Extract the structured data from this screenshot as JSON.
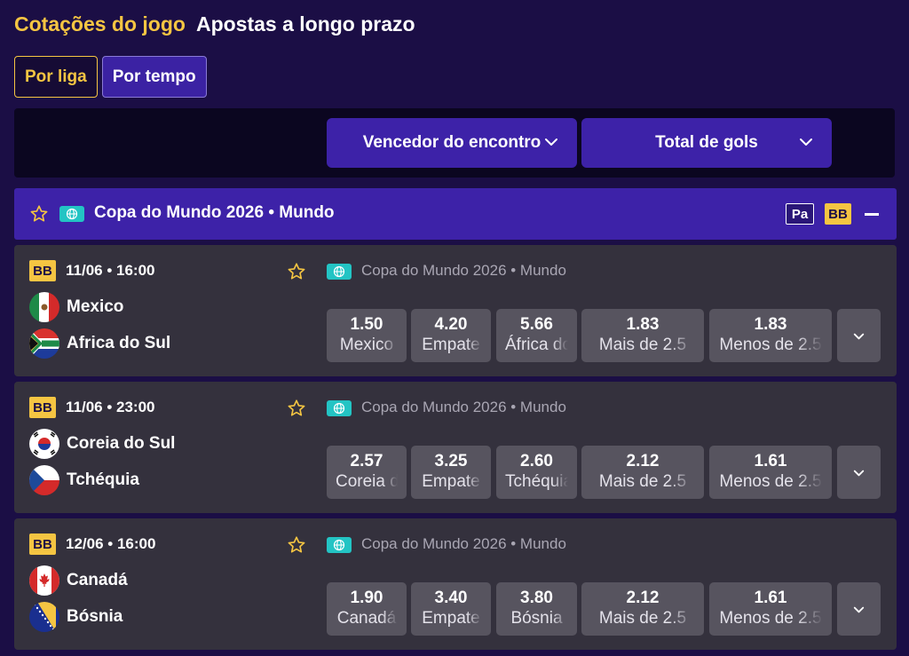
{
  "tabs": {
    "game_odds": "Cotações do jogo",
    "long_term": "Apostas a longo prazo"
  },
  "filters": {
    "by_league": "Por liga",
    "by_time": "Por tempo"
  },
  "markets": {
    "winner": "Vencedor do encontro",
    "total_goals": "Total de gols"
  },
  "league": {
    "title": "Copa do Mundo 2026 • Mundo",
    "badge_pa": "Pa",
    "badge_bb": "BB"
  },
  "matches": [
    {
      "badge": "BB",
      "time": "11/06 • 16:00",
      "league": "Copa do Mundo 2026 • Mundo",
      "team1": "Mexico",
      "team2": "Africa do Sul",
      "flag1": "mexico-flag-icon",
      "flag2": "south-africa-flag-icon",
      "odds": [
        {
          "value": "1.50",
          "label": "Mexico"
        },
        {
          "value": "4.20",
          "label": "Empate"
        },
        {
          "value": "5.66",
          "label": "África do Sul"
        },
        {
          "value": "1.83",
          "label": "Mais de 2.5"
        },
        {
          "value": "1.83",
          "label": "Menos de 2.5"
        }
      ]
    },
    {
      "badge": "BB",
      "time": "11/06 • 23:00",
      "league": "Copa do Mundo 2026 • Mundo",
      "team1": "Coreia do Sul",
      "team2": "Tchéquia",
      "flag1": "south-korea-flag-icon",
      "flag2": "czechia-flag-icon",
      "odds": [
        {
          "value": "2.57",
          "label": "Coreia do Sul"
        },
        {
          "value": "3.25",
          "label": "Empate"
        },
        {
          "value": "2.60",
          "label": "Tchéquia"
        },
        {
          "value": "2.12",
          "label": "Mais de 2.5"
        },
        {
          "value": "1.61",
          "label": "Menos de 2.5"
        }
      ]
    },
    {
      "badge": "BB",
      "time": "12/06 • 16:00",
      "league": "Copa do Mundo 2026 • Mundo",
      "team1": "Canadá",
      "team2": "Bósnia",
      "flag1": "canada-flag-icon",
      "flag2": "bosnia-flag-icon",
      "odds": [
        {
          "value": "1.90",
          "label": "Canadá"
        },
        {
          "value": "3.40",
          "label": "Empate"
        },
        {
          "value": "3.80",
          "label": "Bósnia"
        },
        {
          "value": "2.12",
          "label": "Mais de 2.5"
        },
        {
          "value": "1.61",
          "label": "Menos de 2.5"
        }
      ]
    }
  ],
  "colors": {
    "background": "#1b0e45",
    "accent": "#f5c542",
    "purple": "#3d22a8",
    "card": "#34313d",
    "odd_button": "#57545f",
    "teal": "#23c4c4"
  }
}
